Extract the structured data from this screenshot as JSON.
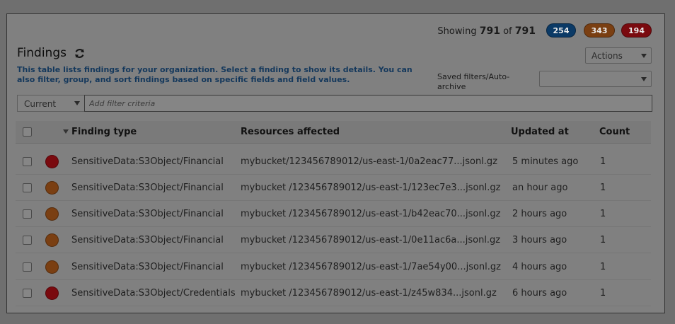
{
  "summary": {
    "showing_label": "Showing",
    "shown_count": "791",
    "of_label": "of",
    "total_count": "791",
    "badges": [
      {
        "label": "254",
        "color": "#0b3a66"
      },
      {
        "label": "343",
        "color": "#7a3f12"
      },
      {
        "label": "194",
        "color": "#7a0a0f"
      }
    ]
  },
  "header": {
    "title": "Findings",
    "refresh_icon": "refresh-icon",
    "description": "This table lists findings for your organization. Select a finding to show its details. You can also filter, group, and sort findings based on specific fields and field values.",
    "actions_label": "Actions",
    "saved_filters_label": "Saved filters/Auto-archive",
    "saved_filters_value": ""
  },
  "filter": {
    "status_value": "Current",
    "placeholder": "Add filter criteria"
  },
  "table": {
    "columns": [
      "Finding type",
      "Resources affected",
      "Updated at",
      "Count"
    ],
    "rows": [
      {
        "severity": "high",
        "severity_color": "#7a0a0f",
        "type": "SensitiveData:S3Object/Financial",
        "resource": "mybucket/123456789012/us-east-1/0a2eac77...jsonl.gz",
        "updated": "5 minutes ago",
        "count": "1"
      },
      {
        "severity": "medium",
        "severity_color": "#7a3f12",
        "type": "SensitiveData:S3Object/Financial",
        "resource": "mybucket /123456789012/us-east-1/123ec7e3...jsonl.gz",
        "updated": "an hour ago",
        "count": "1"
      },
      {
        "severity": "medium",
        "severity_color": "#7a3f12",
        "type": "SensitiveData:S3Object/Financial",
        "resource": "mybucket /123456789012/us-east-1/b42eac70...jsonl.gz",
        "updated": "2 hours ago",
        "count": "1"
      },
      {
        "severity": "medium",
        "severity_color": "#7a3f12",
        "type": "SensitiveData:S3Object/Financial",
        "resource": "mybucket /123456789012/us-east-1/0e11ac6a...jsonl.gz",
        "updated": "3 hours ago",
        "count": "1"
      },
      {
        "severity": "medium",
        "severity_color": "#7a3f12",
        "type": "SensitiveData:S3Object/Financial",
        "resource": "mybucket /123456789012/us-east-1/7ae54y00...jsonl.gz",
        "updated": "4 hours ago",
        "count": "1"
      },
      {
        "severity": "high",
        "severity_color": "#7a0a0f",
        "type": "SensitiveData:S3Object/Credentials",
        "resource": "mybucket /123456789012/us-east-1/z45w834...jsonl.gz",
        "updated": "6 hours ago",
        "count": "1"
      }
    ]
  }
}
